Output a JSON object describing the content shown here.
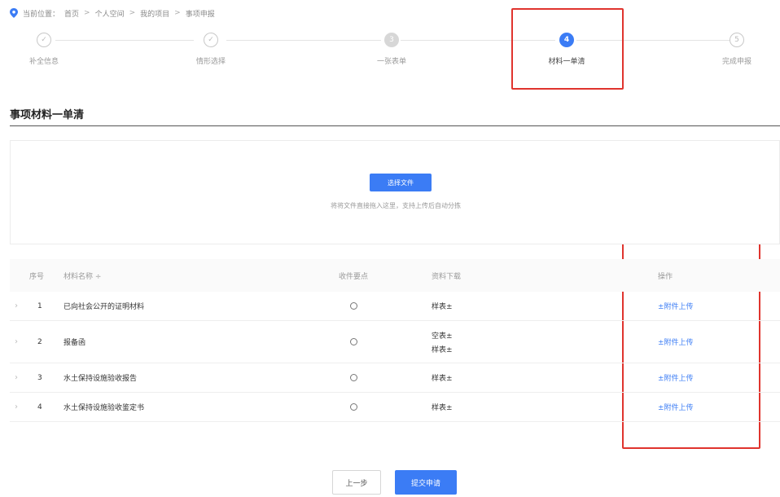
{
  "breadcrumb": {
    "icon": "location-pin-icon",
    "prefix": "当前位置：",
    "items": [
      "首页",
      "个人空间",
      "我的项目",
      "事项申报"
    ],
    "separator": ">"
  },
  "steps": [
    {
      "label": "补全信息",
      "status": "done",
      "marker": "✓"
    },
    {
      "label": "情形选择",
      "status": "done",
      "marker": "✓"
    },
    {
      "label": "一张表单",
      "status": "pending",
      "marker": "3"
    },
    {
      "label": "材料一单清",
      "status": "active",
      "marker": "4"
    },
    {
      "label": "完成申报",
      "status": "future",
      "marker": "5"
    }
  ],
  "section_title": "事项材料一单清",
  "upload": {
    "button_label": "选择文件",
    "hint": "将将文件直接拖入这里，支持上传后自动分拣"
  },
  "table": {
    "headers": [
      "序号",
      "材料名称 ÷",
      "收件要点",
      "资料下载",
      "操作"
    ],
    "rows": [
      {
        "index": "1",
        "name": "已向社会公开的证明材料",
        "templates": [
          "样表±"
        ],
        "action": "±附件上传"
      },
      {
        "index": "2",
        "name": "报备函",
        "templates": [
          "空表±",
          "样表±"
        ],
        "action": "±附件上传"
      },
      {
        "index": "3",
        "name": "水土保持设施验收报告",
        "templates": [
          "样表±"
        ],
        "action": "±附件上传"
      },
      {
        "index": "4",
        "name": "水土保持设施验收鉴定书",
        "templates": [
          "样表±"
        ],
        "action": "±附件上传"
      }
    ]
  },
  "buttons": {
    "prev": "上一步",
    "submit": "提交申请"
  },
  "colors": {
    "accent": "#3b7cf5",
    "highlight_box": "#e0342e"
  }
}
